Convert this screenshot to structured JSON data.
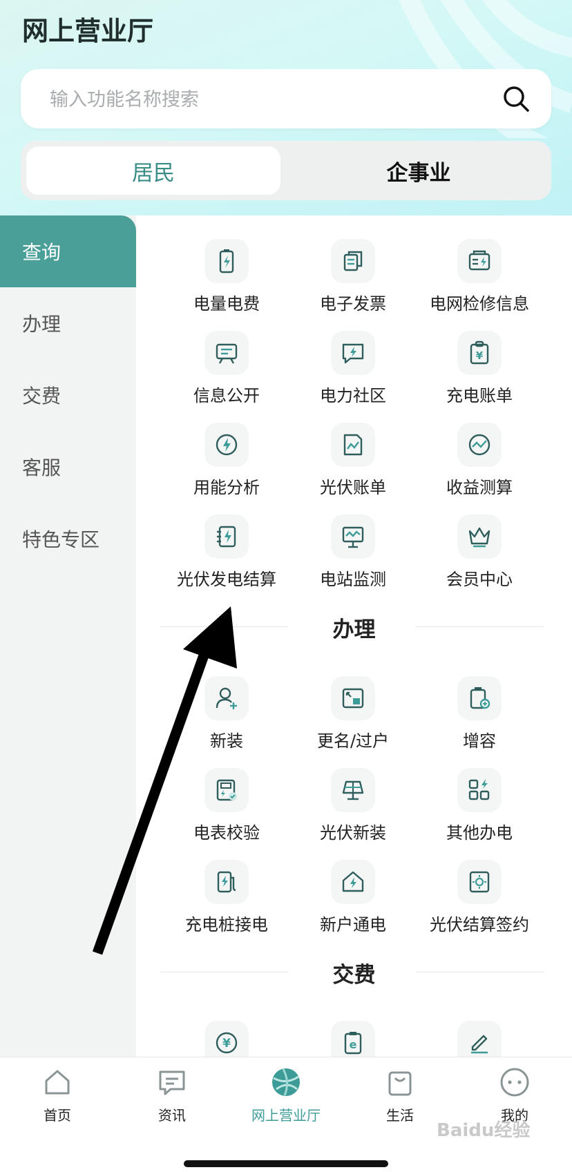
{
  "header": {
    "title": "网上营业厅"
  },
  "search": {
    "placeholder": "输入功能名称搜索"
  },
  "segment": {
    "tabs": [
      "居民",
      "企事业"
    ],
    "selected": "居民"
  },
  "sidebar": {
    "items": [
      "查询",
      "办理",
      "交费",
      "客服",
      "特色专区"
    ],
    "active": "查询"
  },
  "sections": {
    "query": {
      "items": [
        {
          "label": "电量电费",
          "icon": "battery-bolt-icon"
        },
        {
          "label": "电子发票",
          "icon": "invoice-icon"
        },
        {
          "label": "电网检修信息",
          "icon": "maintenance-info-icon"
        },
        {
          "label": "信息公开",
          "icon": "notice-board-icon"
        },
        {
          "label": "电力社区",
          "icon": "community-chat-icon"
        },
        {
          "label": "充电账单",
          "icon": "charging-bill-icon"
        },
        {
          "label": "用能分析",
          "icon": "energy-analysis-icon"
        },
        {
          "label": "光伏账单",
          "icon": "pv-bill-icon"
        },
        {
          "label": "收益测算",
          "icon": "revenue-gauge-icon"
        },
        {
          "label": "光伏发电结算",
          "icon": "pv-settlement-icon"
        },
        {
          "label": "电站监测",
          "icon": "station-monitor-icon"
        },
        {
          "label": "会员中心",
          "icon": "crown-icon"
        }
      ]
    },
    "handle": {
      "title": "办理",
      "items": [
        {
          "label": "新装",
          "icon": "add-user-icon"
        },
        {
          "label": "更名/过户",
          "icon": "rename-transfer-icon"
        },
        {
          "label": "增容",
          "icon": "capacity-increase-icon"
        },
        {
          "label": "电表校验",
          "icon": "meter-check-icon"
        },
        {
          "label": "光伏新装",
          "icon": "solar-panel-icon"
        },
        {
          "label": "其他办电",
          "icon": "other-services-icon"
        },
        {
          "label": "充电桩接电",
          "icon": "charging-pile-icon"
        },
        {
          "label": "新户通电",
          "icon": "house-bolt-icon"
        },
        {
          "label": "光伏结算签约",
          "icon": "sun-contract-icon"
        }
      ]
    },
    "pay": {
      "title": "交费",
      "items": [
        {
          "icon": "yuan-coin-icon"
        },
        {
          "icon": "e-bill-icon"
        },
        {
          "icon": "pen-sign-icon"
        }
      ]
    }
  },
  "tabbar": {
    "items": [
      {
        "label": "首页",
        "icon": "home-icon"
      },
      {
        "label": "资讯",
        "icon": "message-icon"
      },
      {
        "label": "网上营业厅",
        "icon": "globe-icon"
      },
      {
        "label": "生活",
        "icon": "shopping-bag-icon"
      },
      {
        "label": "我的",
        "icon": "smiley-icon"
      }
    ],
    "active": "网上营业厅"
  },
  "watermark": {
    "text": "Baidu经验"
  },
  "colors": {
    "accent": "#4a9f99",
    "active_tab": "#3d9b98",
    "icon_stroke": "#2f5d5b"
  }
}
